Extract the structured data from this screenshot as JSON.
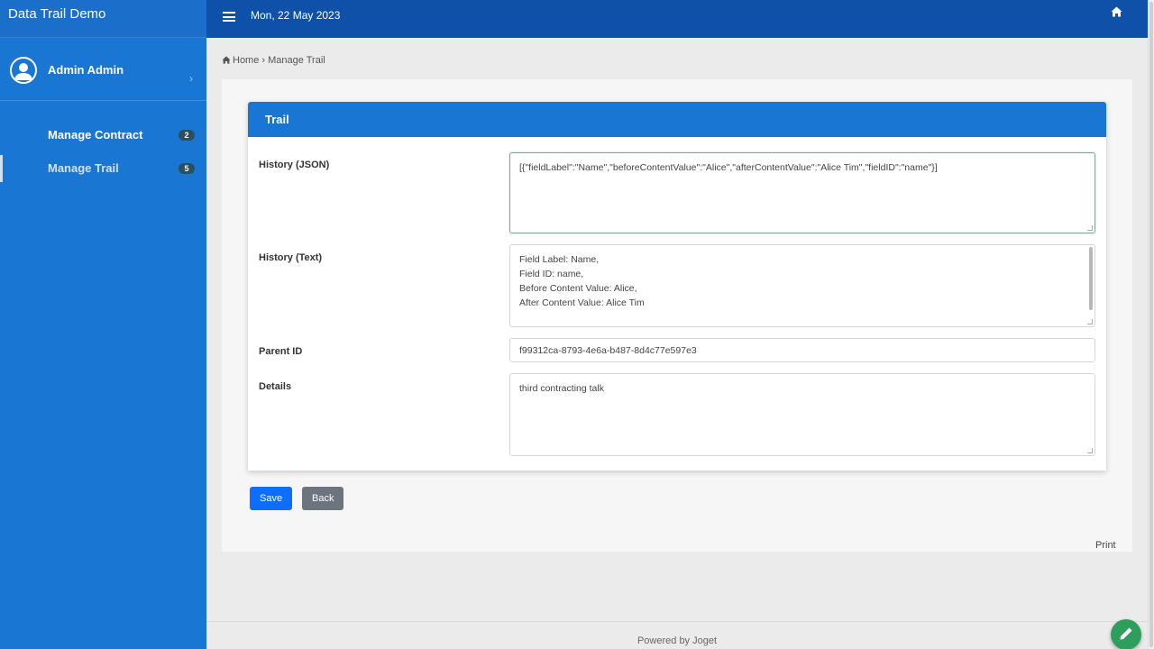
{
  "app": {
    "title": "Data Trail Demo"
  },
  "user": {
    "name": "Admin Admin"
  },
  "sidebar": {
    "items": [
      {
        "label": "Manage Contract",
        "badge": "2"
      },
      {
        "label": "Manage Trail",
        "badge": "5"
      }
    ]
  },
  "header": {
    "date": "Mon, 22 May 2023"
  },
  "breadcrumb": {
    "home": "Home",
    "separator": "›",
    "current": "Manage Trail"
  },
  "form": {
    "title": "Trail",
    "history_json": {
      "label": "History (JSON)",
      "value": "[{\"fieldLabel\":\"Name\",\"beforeContentValue\":\"Alice\",\"afterContentValue\":\"Alice Tim\",\"fieldID\":\"name\"}]"
    },
    "history_text": {
      "label": "History (Text)",
      "lines": [
        "Field Label: Name,",
        "Field ID: name,",
        "Before Content Value: Alice,",
        "After Content Value: Alice Tim"
      ]
    },
    "parent_id": {
      "label": "Parent ID",
      "value": "f99312ca-8793-4e6a-b487-8d4c77e597e3"
    },
    "details": {
      "label": "Details",
      "value": "third contracting talk"
    }
  },
  "actions": {
    "save": "Save",
    "back": "Back",
    "print": "Print"
  },
  "footer": {
    "text": "Powered by Joget"
  },
  "colors": {
    "sidebar": "#1976d2",
    "header": "#0d52a8",
    "save": "#0d6efd",
    "back": "#6c757d",
    "fab": "#2e9e5d",
    "badge": "#2a4f5e"
  },
  "icons": {
    "avatar": "user-circle-icon",
    "menu": "hamburger-icon",
    "home": "home-icon",
    "edit": "pencil-icon"
  }
}
